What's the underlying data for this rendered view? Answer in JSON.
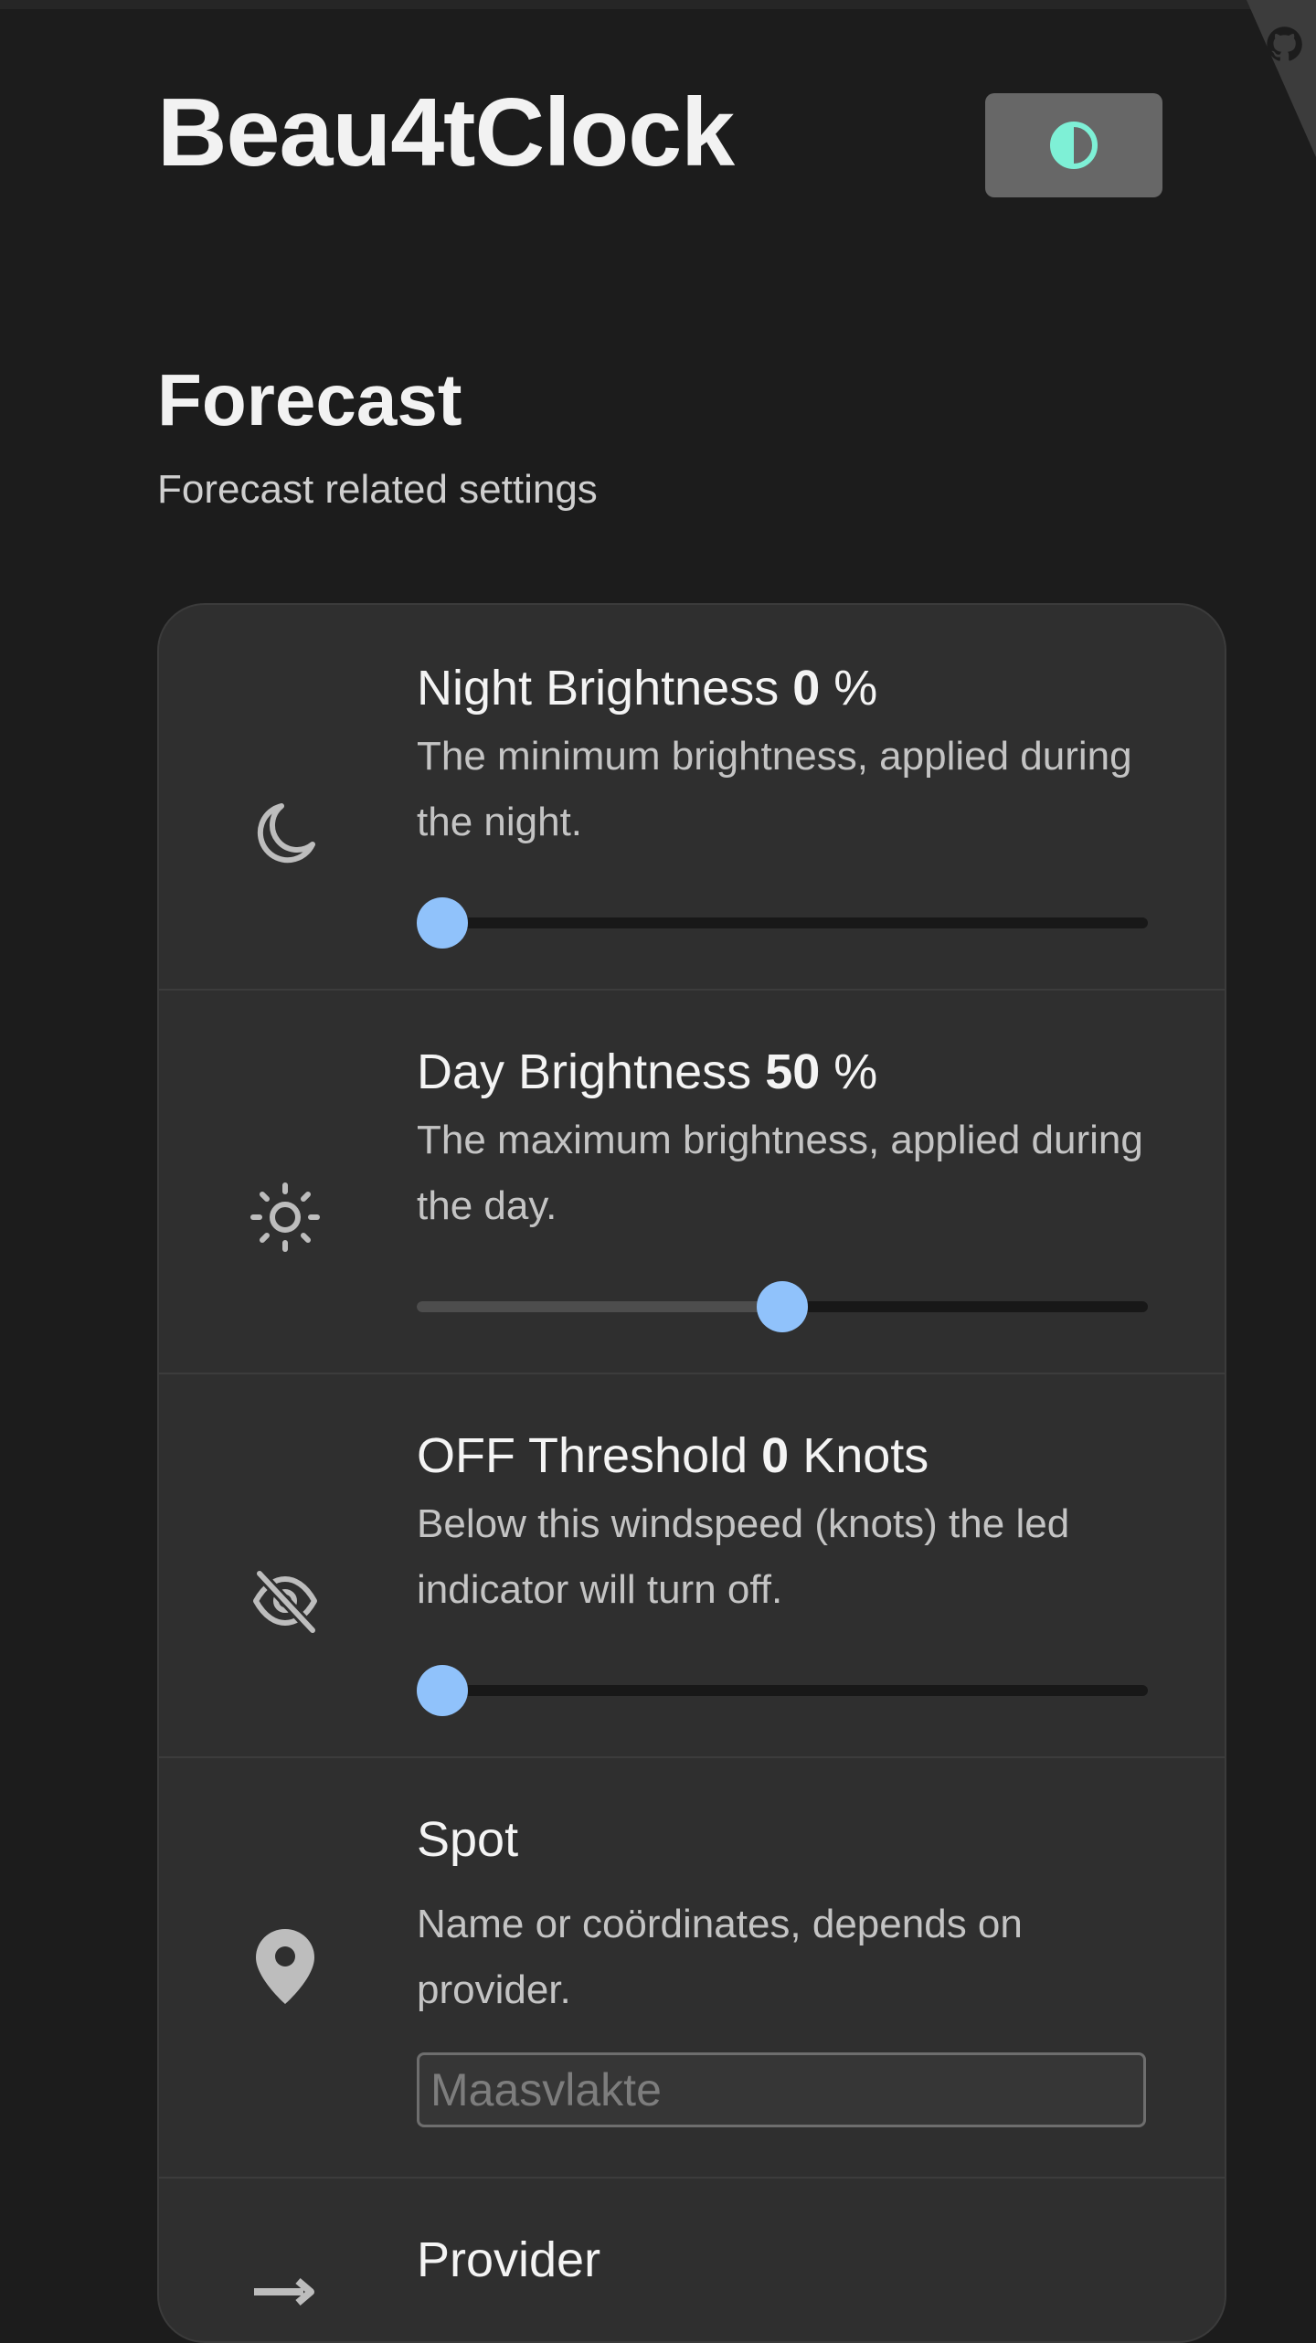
{
  "header": {
    "app_title": "Beau4tClock",
    "theme_toggle_icon": "contrast-icon",
    "accent_color": "#7ef0d6",
    "corner_icon": "github-octocat-icon"
  },
  "section": {
    "title": "Forecast",
    "subtitle": "Forecast related settings"
  },
  "settings": {
    "night_brightness": {
      "icon": "moon-icon",
      "title_prefix": "Night Brightness",
      "value": "0",
      "unit": "%",
      "description": "The minimum brightness, applied during the night.",
      "slider_fraction": 0.0
    },
    "day_brightness": {
      "icon": "sun-icon",
      "title_prefix": "Day Brightness",
      "value": "50",
      "unit": "%",
      "description": "The maximum brightness, applied during the day.",
      "slider_fraction": 0.5
    },
    "off_threshold": {
      "icon": "eye-off-icon",
      "title_prefix": "OFF Threshold",
      "value": "0",
      "unit": "Knots",
      "description": "Below this windspeed (knots) the led indicator will turn off.",
      "slider_fraction": 0.0
    },
    "spot": {
      "icon": "location-pin-icon",
      "title": "Spot",
      "description": "Name or coördinates, depends on provider.",
      "placeholder": "Maasvlakte",
      "value": ""
    },
    "provider": {
      "icon": "provider-arrow-icon",
      "title": "Provider"
    }
  },
  "colors": {
    "slider_thumb": "#90c2fb",
    "background": "#1c1c1c",
    "card": "#2f2f2f"
  }
}
